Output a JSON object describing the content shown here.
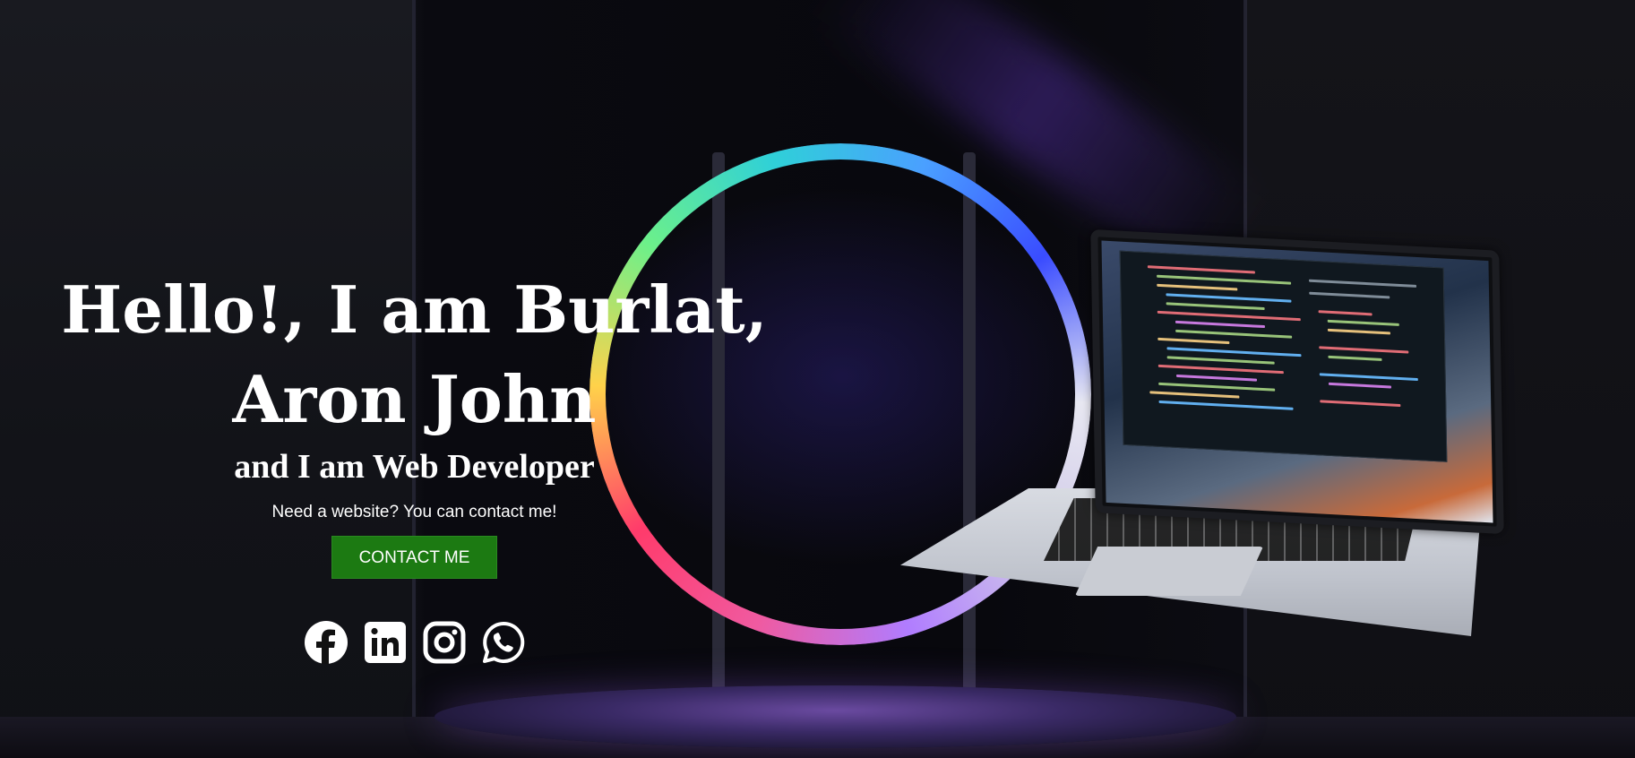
{
  "hero": {
    "heading": "Hello!, I am Burlat, Aron John",
    "subheading": "and I am Web Developer",
    "tagline": "Need a website? You can contact me!",
    "contact_button_label": "CONTACT ME"
  },
  "social_links": [
    {
      "icon": "facebook-icon"
    },
    {
      "icon": "linkedin-icon"
    },
    {
      "icon": "instagram-icon"
    },
    {
      "icon": "whatsapp-icon"
    }
  ],
  "colors": {
    "button_bg": "#1c7a12",
    "text": "#ffffff",
    "background": "#07070c"
  }
}
